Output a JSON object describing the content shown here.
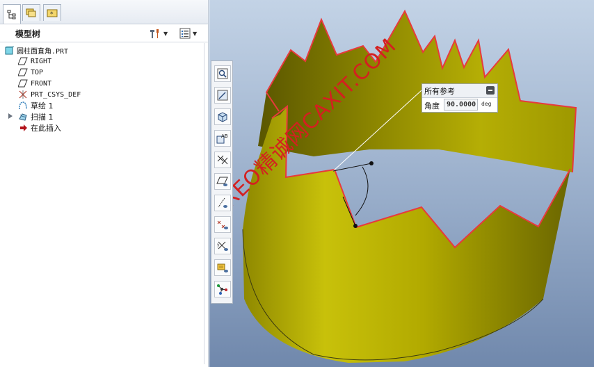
{
  "model_tree": {
    "title": "模型树",
    "tabs": [
      "model-tree",
      "folder-browser",
      "favorites"
    ],
    "items": [
      {
        "label": "圆柱面直角.PRT",
        "icon": "part-icon",
        "indent": 0
      },
      {
        "label": "RIGHT",
        "icon": "datum-plane-icon",
        "indent": 1
      },
      {
        "label": "TOP",
        "icon": "datum-plane-icon",
        "indent": 1
      },
      {
        "label": "FRONT",
        "icon": "datum-plane-icon",
        "indent": 1
      },
      {
        "label": "PRT_CSYS_DEF",
        "icon": "coordinate-system-icon",
        "indent": 1
      },
      {
        "label": "草绘 1",
        "icon": "sketch-icon",
        "indent": 1
      },
      {
        "label": "扫描 1",
        "icon": "sweep-icon",
        "indent": 1,
        "expandable": true
      },
      {
        "label": "在此插入",
        "icon": "insert-here-arrow-icon",
        "indent": 1
      }
    ]
  },
  "view_toolbar": {
    "buttons": [
      "zoom-icon",
      "repaint-icon",
      "saved-orientation-icon",
      "annotation-display-icon",
      "axis-display-icon",
      "plane-display-icon",
      "datum-axis-icon",
      "point-display-icon",
      "csys-display-icon",
      "annotation-toggle-icon",
      "spin-center-icon"
    ]
  },
  "dimension_box": {
    "reference_label": "所有参考",
    "angle_label": "角度",
    "value": "90.0000",
    "unit": "deg"
  },
  "watermark": "CREO精诚网CAXIT.COM",
  "colors": {
    "surface": "#b9b000",
    "edge_highlight": "#e8393c",
    "background_top": "#c3d3e6",
    "background_bottom": "#7088ac"
  }
}
